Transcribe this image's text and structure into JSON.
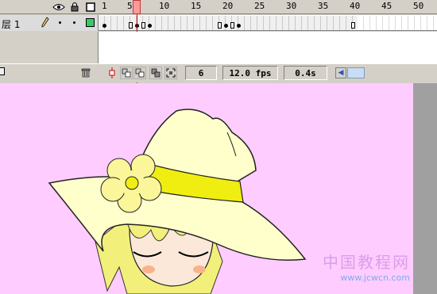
{
  "timeline": {
    "header": {
      "icons": [
        "eye-icon",
        "lock-icon",
        "outline-icon"
      ],
      "ruler_labels": [
        "1",
        "5",
        "10",
        "15",
        "20",
        "25",
        "30",
        "35",
        "40",
        "45",
        "50"
      ],
      "current_frame": 6
    },
    "layer": {
      "name": "层 1",
      "color": "#33cc66"
    },
    "bottom": {
      "frame": "6",
      "fps": "12.0 fps",
      "time": "0.4s"
    }
  },
  "stage": {
    "background": "#ffccff",
    "watermark_cn": "中国教程网",
    "watermark_url": "www.jcwcn.com"
  }
}
